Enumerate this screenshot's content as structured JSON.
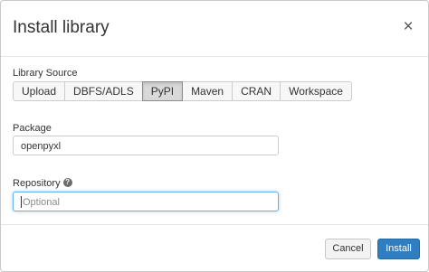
{
  "dialog": {
    "title": "Install library",
    "close_glyph": "×"
  },
  "library_source": {
    "label": "Library Source",
    "options": [
      "Upload",
      "DBFS/ADLS",
      "PyPI",
      "Maven",
      "CRAN",
      "Workspace"
    ],
    "selected": "PyPI"
  },
  "package": {
    "label": "Package",
    "value": "openpyxl"
  },
  "repository": {
    "label": "Repository",
    "help_icon": "?",
    "placeholder": "Optional",
    "value": ""
  },
  "footer": {
    "cancel_label": "Cancel",
    "install_label": "Install"
  },
  "colors": {
    "primary": "#2f7ec1",
    "focus_border": "#66afe9",
    "selected_segment": "#d9d9d9"
  }
}
